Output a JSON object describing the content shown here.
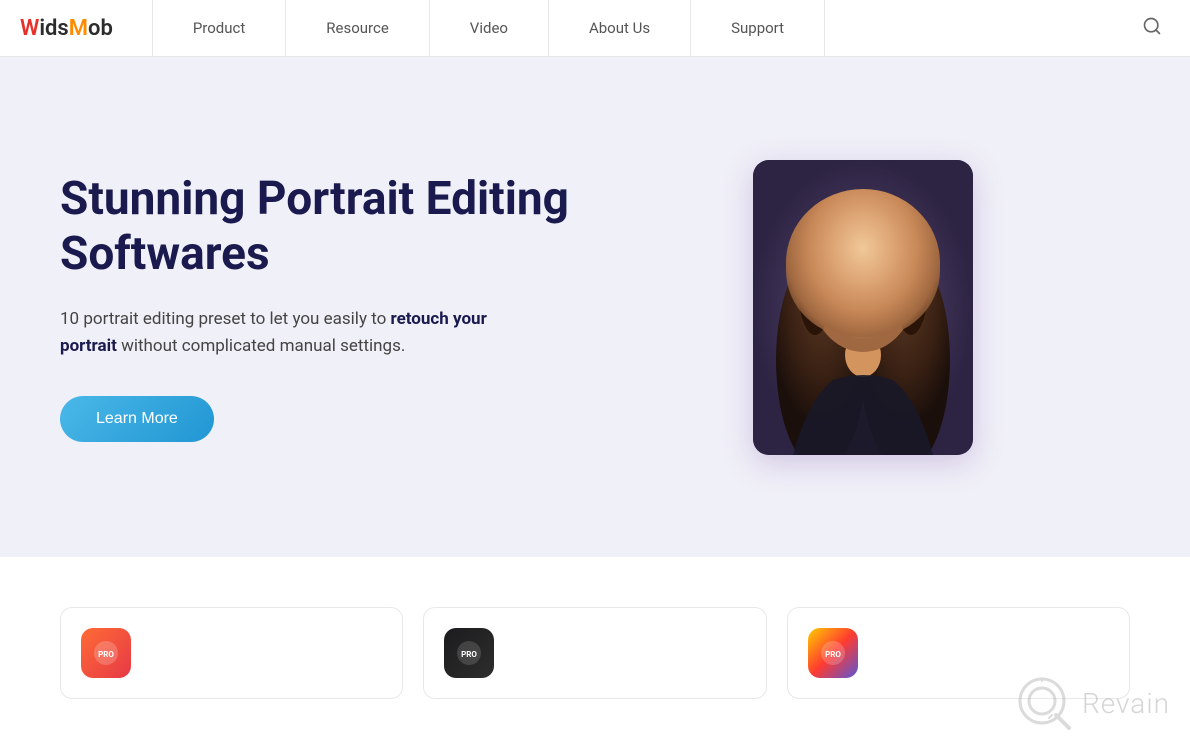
{
  "navbar": {
    "logo": "WidsMob",
    "logo_parts": {
      "w": "W",
      "ids": "ids",
      "m": "M",
      "ob": "ob"
    },
    "nav_items": [
      {
        "id": "product",
        "label": "Product"
      },
      {
        "id": "resource",
        "label": "Resource"
      },
      {
        "id": "video",
        "label": "Video"
      },
      {
        "id": "about-us",
        "label": "About Us"
      },
      {
        "id": "support",
        "label": "Support"
      }
    ],
    "search_aria": "Search"
  },
  "hero": {
    "title": "Stunning Portrait Editing Softwares",
    "description_plain": "10 portrait editing preset to let you easily to ",
    "description_bold": "retouch your portrait",
    "description_end": " without complicated manual settings.",
    "learn_more_label": "Learn More"
  },
  "products": {
    "cards": [
      {
        "id": "card-1",
        "icon_color": "red",
        "icon_label": "pro-icon-red"
      },
      {
        "id": "card-2",
        "icon_color": "dark",
        "icon_label": "pro-icon-dark"
      },
      {
        "id": "card-3",
        "icon_color": "colorful",
        "icon_label": "pro-icon-colorful"
      }
    ]
  },
  "watermark": {
    "brand": "Revain"
  }
}
